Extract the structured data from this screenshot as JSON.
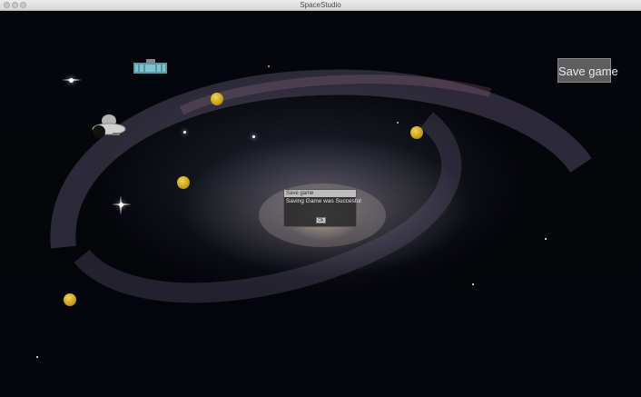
{
  "window": {
    "title": "SpaceStudio"
  },
  "buttons": {
    "save_game": "Save game"
  },
  "dialog": {
    "title": "Save game",
    "message": "Saving Game was Succesful",
    "ok_label": "Ok"
  },
  "colors": {
    "coin": "#d4aa22",
    "button_bg": "#6e6e6e",
    "dialog_bg": "#2d2d2d"
  },
  "sprites": [
    "space-station",
    "ufo",
    "coin",
    "coin",
    "coin",
    "coin"
  ]
}
